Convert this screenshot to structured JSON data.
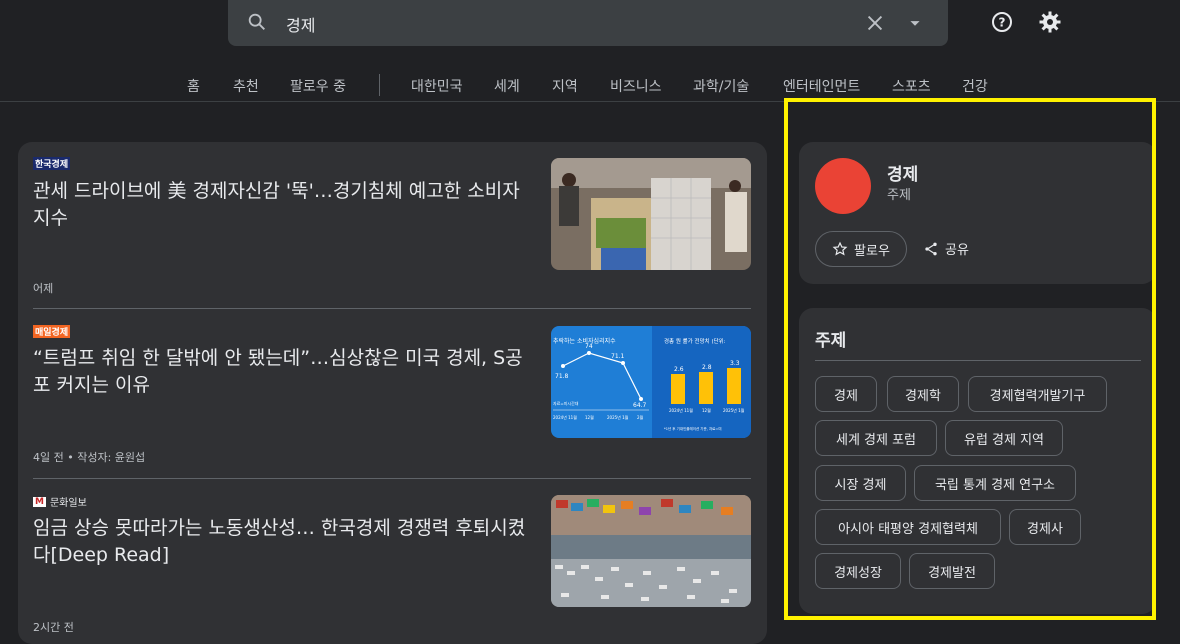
{
  "search": {
    "query": "경제"
  },
  "nav": [
    "홈",
    "추천",
    "팔로우 중",
    "대한민국",
    "세계",
    "지역",
    "비즈니스",
    "과학/기술",
    "엔터테인먼트",
    "스포츠",
    "건강"
  ],
  "articles": [
    {
      "source": "한국경제",
      "title": "관세 드라이브에 美 경제자신감 '뚝'…경기침체 예고한 소비자지수",
      "meta": "어제"
    },
    {
      "source": "매일경제",
      "title": "“트럼프 취임 한 달밖에 안 됐는데”…심상찮은 미국 경제, S공포 커지는 이유",
      "meta": "4일 전 • 작성자: 윤원섭",
      "chart_left": {
        "title": "추락하는 소비자심리지수",
        "values": [
          "71.8",
          "74",
          "71.1",
          "64.7"
        ],
        "xlabels": [
          "2024년 11월",
          "12월",
          "2025년 1월",
          "2월"
        ],
        "note": "자료=미시간대"
      },
      "chart_right": {
        "title": "경총 뭔 률가 전망치 (단위:",
        "values": [
          "2.6",
          "2.8",
          "3.3"
        ],
        "xlabels": [
          "2024년 11월",
          "12월",
          "2025년 1월"
        ],
        "note": "*1년 후 기대인플레이션 기준, 자료=미"
      }
    },
    {
      "source": "문화일보",
      "title": "임금 상승 못따라가는 노동생산성… 한국경제 경쟁력 후퇴시켰다[Deep Read]",
      "meta": "2시간 전"
    }
  ],
  "topic": {
    "name": "경제",
    "type": "주제",
    "follow": "팔로우",
    "share": "공유"
  },
  "related": {
    "title": "주제",
    "chips": [
      "경제",
      "경제학",
      "경제협력개발기구",
      "세계 경제 포럼",
      "유럽 경제 지역",
      "시장 경제",
      "국립 통계 경제 연구소",
      "아시아 태평양 경제협력체",
      "경제사",
      "경제성장",
      "경제발전"
    ]
  },
  "colors": {
    "bg": "#202124",
    "card": "#303134",
    "topic_circle": "#ea4335",
    "highlight": "#fff200"
  }
}
